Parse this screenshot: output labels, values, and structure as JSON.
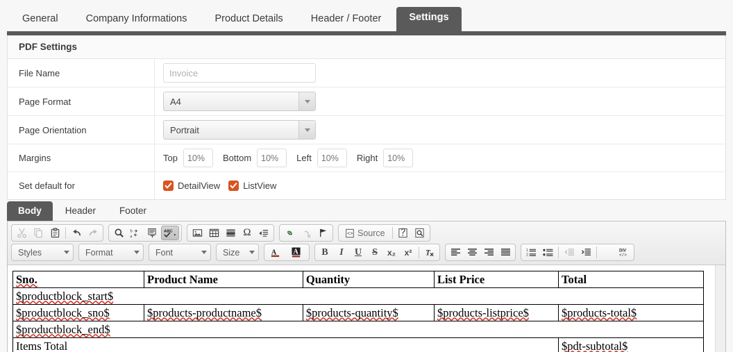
{
  "top_tabs": [
    {
      "label": "General",
      "active": false
    },
    {
      "label": "Company Informations",
      "active": false
    },
    {
      "label": "Product Details",
      "active": false
    },
    {
      "label": "Header / Footer",
      "active": false
    },
    {
      "label": "Settings",
      "active": true
    }
  ],
  "panel": {
    "title": "PDF Settings",
    "rows": {
      "file_name": {
        "label": "File Name",
        "value": "",
        "placeholder": "Invoice"
      },
      "page_format": {
        "label": "Page Format",
        "value": "A4",
        "options": [
          "A4"
        ]
      },
      "page_orientation": {
        "label": "Page Orientation",
        "value": "Portrait",
        "options": [
          "Portrait"
        ]
      },
      "margins": {
        "label": "Margins",
        "fields": [
          {
            "label": "Top",
            "value": "",
            "placeholder": "10%"
          },
          {
            "label": "Bottom",
            "value": "",
            "placeholder": "10%"
          },
          {
            "label": "Left",
            "value": "",
            "placeholder": "10%"
          },
          {
            "label": "Right",
            "value": "",
            "placeholder": "10%"
          }
        ]
      },
      "set_default_for": {
        "label": "Set default for",
        "checkboxes": [
          {
            "label": "DetailView",
            "checked": true
          },
          {
            "label": "ListView",
            "checked": true
          }
        ]
      }
    }
  },
  "editor_tabs": [
    {
      "label": "Body",
      "active": true
    },
    {
      "label": "Header",
      "active": false
    },
    {
      "label": "Footer",
      "active": false
    }
  ],
  "toolbar": {
    "row1": [
      {
        "group": [
          {
            "name": "cut-icon",
            "title": "Cut",
            "dim": true
          },
          {
            "name": "copy-icon",
            "title": "Copy",
            "dim": true
          },
          {
            "name": "paste-icon",
            "title": "Paste",
            "dim": false
          },
          {
            "sep": true
          },
          {
            "name": "undo-icon",
            "title": "Undo",
            "dim": false
          },
          {
            "name": "redo-icon",
            "title": "Redo",
            "dim": true
          }
        ]
      },
      {
        "group": [
          {
            "name": "find-icon",
            "title": "Find",
            "dim": false
          },
          {
            "name": "replace-icon",
            "title": "Replace",
            "dim": false
          },
          {
            "name": "select-all-icon",
            "title": "Select All",
            "dim": false
          },
          {
            "name": "spell-check-icon",
            "title": "Spell Check As You Type",
            "dim": false,
            "active": true
          }
        ]
      },
      {
        "group": [
          {
            "name": "image-icon",
            "title": "Image",
            "dim": false
          },
          {
            "name": "table-icon",
            "title": "Table",
            "dim": false
          },
          {
            "name": "horizontal-rule-icon",
            "title": "Horizontal Line",
            "dim": false
          },
          {
            "name": "special-character-icon",
            "title": "Insert Special Character",
            "dim": false
          },
          {
            "name": "page-break-icon",
            "title": "Page Break",
            "dim": false
          }
        ]
      },
      {
        "group": [
          {
            "name": "link-icon",
            "title": "Link",
            "dim": false
          },
          {
            "name": "unlink-icon",
            "title": "Unlink",
            "dim": true
          },
          {
            "name": "anchor-icon",
            "title": "Anchor",
            "dim": false
          }
        ]
      },
      {
        "group": [
          {
            "name": "source-button",
            "title": "Source",
            "label": "Source",
            "dim": false
          },
          {
            "sep": true
          },
          {
            "name": "templates-icon",
            "title": "Templates",
            "dim": false
          },
          {
            "name": "preview-icon",
            "title": "Preview",
            "dim": false
          }
        ]
      }
    ],
    "combos": [
      {
        "name": "styles-combo",
        "label": "Styles"
      },
      {
        "name": "format-combo",
        "label": "Format"
      },
      {
        "name": "font-combo",
        "label": "Font"
      },
      {
        "name": "size-combo",
        "label": "Size"
      }
    ],
    "row2": [
      {
        "group": [
          {
            "name": "text-color-icon",
            "title": "Text Color",
            "dim": false
          },
          {
            "name": "background-color-icon",
            "title": "Background Color",
            "dim": false
          }
        ]
      },
      {
        "group": [
          {
            "name": "bold-icon",
            "title": "Bold",
            "label": "B"
          },
          {
            "name": "italic-icon",
            "title": "Italic",
            "label": "I"
          },
          {
            "name": "underline-icon",
            "title": "Underline",
            "label": "U"
          },
          {
            "name": "strikethrough-icon",
            "title": "Strike Through",
            "label": "S"
          },
          {
            "name": "subscript-icon",
            "title": "Subscript",
            "label": "x₂"
          },
          {
            "name": "superscript-icon",
            "title": "Superscript",
            "label": "x²"
          },
          {
            "sep": true
          },
          {
            "name": "remove-format-icon",
            "title": "Remove Format"
          }
        ]
      },
      {
        "group": [
          {
            "name": "align-left-icon",
            "title": "Align Left"
          },
          {
            "name": "align-center-icon",
            "title": "Center"
          },
          {
            "name": "align-right-icon",
            "title": "Align Right"
          },
          {
            "name": "align-justify-icon",
            "title": "Justify"
          }
        ]
      },
      {
        "group": [
          {
            "name": "numbered-list-icon",
            "title": "Insert/Remove Numbered List"
          },
          {
            "name": "bulleted-list-icon",
            "title": "Insert/Remove Bulleted List"
          },
          {
            "sep": true
          },
          {
            "name": "decrease-indent-icon",
            "title": "Decrease Indent",
            "dim": true
          },
          {
            "name": "increase-indent-icon",
            "title": "Increase Indent"
          },
          {
            "sep": true
          },
          {
            "name": "blockquote-icon",
            "title": "Block Quote",
            "label": "”"
          },
          {
            "name": "div-container-icon",
            "title": "Create Div Container"
          }
        ]
      }
    ]
  },
  "document": {
    "columns": [
      "Sno.",
      "Product Name",
      "Quantity",
      "List Price",
      "Total"
    ],
    "col_widths": [
      "19%",
      "23%",
      "19%",
      "18%",
      "21%"
    ],
    "rows": [
      {
        "type": "header",
        "cells": [
          "Sno.",
          "Product Name",
          "Quantity",
          "List Price",
          "Total"
        ]
      },
      {
        "type": "full",
        "cells": [
          "$productblock_start$"
        ]
      },
      {
        "type": "data",
        "cells": [
          "$productblock_sno$",
          "$products-productname$",
          "$products-quantity$",
          "$products-listprice$",
          "$products-total$"
        ]
      },
      {
        "type": "full",
        "cells": [
          "$productblock_end$"
        ]
      },
      {
        "type": "total",
        "cells": [
          "Items Total",
          "$pdt-subtotal$"
        ]
      }
    ]
  },
  "colors": {
    "active_tab_bg": "#5a5a5a",
    "checkbox": "#d9541e",
    "spell_underline": "#d03a2a",
    "strip": "#5a5a5a"
  }
}
